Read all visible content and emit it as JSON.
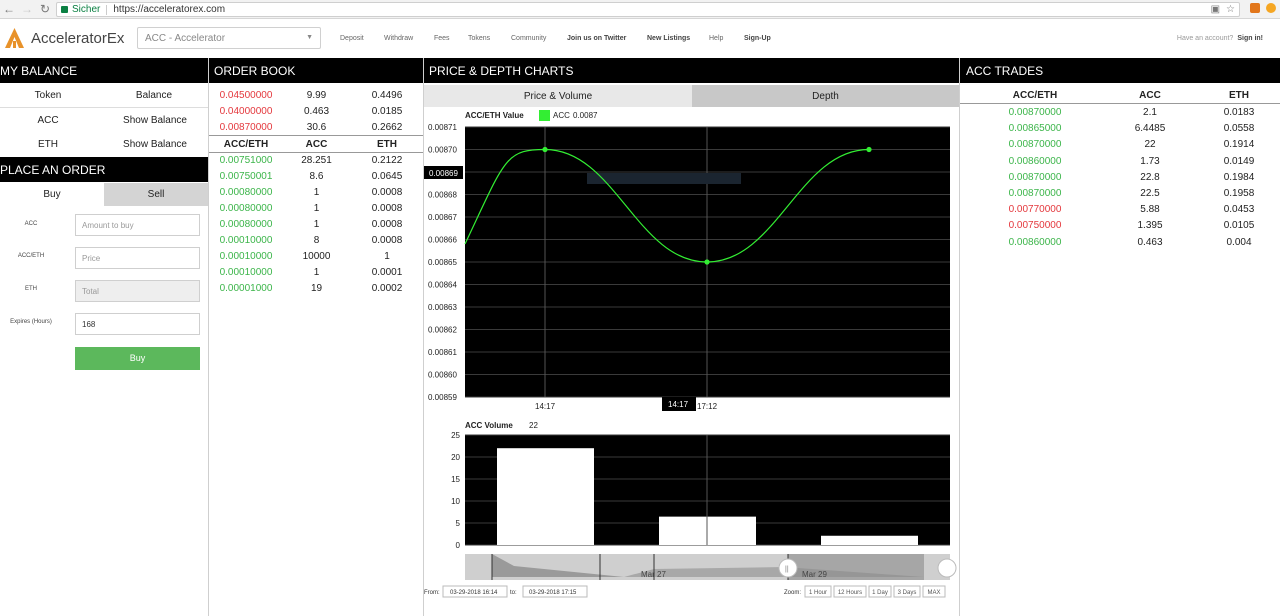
{
  "browser": {
    "secure_label": "Sicher",
    "url": "https://acceleratorex.com"
  },
  "header": {
    "brand": "AcceleratorEx",
    "pair_select": "ACC - Accelerator",
    "nav": [
      "Deposit",
      "Withdraw",
      "Fees",
      "Tokens",
      "Community",
      "Join us on Twitter",
      "New Listings",
      "Help",
      "Sign-Up"
    ],
    "have_account": "Have an account?",
    "sign_in": "Sign in!"
  },
  "balance": {
    "title": "MY BALANCE",
    "col_token": "Token",
    "col_balance": "Balance",
    "rows": [
      {
        "token": "ACC",
        "action": "Show Balance"
      },
      {
        "token": "ETH",
        "action": "Show Balance"
      }
    ]
  },
  "order_form": {
    "title": "PLACE AN ORDER",
    "tab_buy": "Buy",
    "tab_sell": "Sell",
    "label_acc": "ACC",
    "placeholder_acc": "Amount to buy",
    "label_price": "ACC/ETH",
    "placeholder_price": "Price",
    "label_eth": "ETH",
    "placeholder_total": "Total",
    "label_expires": "Expires (Hours)",
    "expires_value": "168",
    "submit": "Buy"
  },
  "order_book": {
    "title": "ORDER BOOK",
    "headers": [
      "ACC/ETH",
      "ACC",
      "ETH"
    ],
    "asks": [
      [
        "0.04500000",
        "9.99",
        "0.4496"
      ],
      [
        "0.04000000",
        "0.463",
        "0.0185"
      ],
      [
        "0.00870000",
        "30.6",
        "0.2662"
      ]
    ],
    "bids": [
      [
        "0.00751000",
        "28.251",
        "0.2122"
      ],
      [
        "0.00750001",
        "8.6",
        "0.0645"
      ],
      [
        "0.00080000",
        "1",
        "0.0008"
      ],
      [
        "0.00080000",
        "1",
        "0.0008"
      ],
      [
        "0.00080000",
        "1",
        "0.0008"
      ],
      [
        "0.00010000",
        "8",
        "0.0008"
      ],
      [
        "0.00010000",
        "10000",
        "1"
      ],
      [
        "0.00010000",
        "1",
        "0.0001"
      ],
      [
        "0.00001000",
        "19",
        "0.0002"
      ]
    ]
  },
  "charts": {
    "title": "PRICE & DEPTH CHARTS",
    "tab_price_volume": "Price & Volume",
    "tab_depth": "Depth",
    "price_title": "ACC/ETH Value",
    "legend_label": "ACC",
    "legend_value": "0.0087",
    "crosshair_y": "0.00869",
    "crosshair_x": "14:17",
    "volume_title": "ACC Volume",
    "volume_value": "22",
    "from_label": "From:",
    "from_value": "03-29-2018 16:14",
    "to_label": "to:",
    "to_value": "03-29-2018 17:15",
    "zoom_label": "Zoom:",
    "zoom_options": [
      "1 Hour",
      "12 Hours",
      "1 Day",
      "3 Days",
      "MAX"
    ],
    "navigator_labels": [
      "Mar 27",
      "Mar 29"
    ],
    "colors": {
      "line": "#33ee33",
      "plot_bg": "#000000",
      "bars": "#ffffff"
    }
  },
  "chart_data": [
    {
      "type": "line",
      "series": [
        {
          "name": "ACC",
          "x": [
            "14:17",
            "17:12",
            "end"
          ],
          "values": [
            0.0087,
            0.00865,
            0.0087
          ]
        }
      ],
      "x_ticks": [
        "14:17",
        "17:12"
      ],
      "y_ticks": [
        "0.00871",
        "0.00870",
        "0.00869",
        "0.00868",
        "0.00867",
        "0.00866",
        "0.00865",
        "0.00864",
        "0.00863",
        "0.00862",
        "0.00861",
        "0.00860",
        "0.00859"
      ],
      "ylim": [
        0.00859,
        0.00871
      ],
      "title": "ACC/ETH Value"
    },
    {
      "type": "bar",
      "values": [
        22,
        6.4485,
        2.1
      ],
      "y_ticks": [
        "25",
        "20",
        "15",
        "10",
        "5",
        "0"
      ],
      "ylim": [
        0,
        25
      ],
      "title": "ACC Volume"
    }
  ],
  "trades": {
    "title": "ACC TRADES",
    "headers": [
      "ACC/ETH",
      "ACC",
      "ETH"
    ],
    "rows": [
      {
        "price": "0.00870000",
        "acc": "2.1",
        "eth": "0.0183",
        "side": "buy"
      },
      {
        "price": "0.00865000",
        "acc": "6.4485",
        "eth": "0.0558",
        "side": "buy"
      },
      {
        "price": "0.00870000",
        "acc": "22",
        "eth": "0.1914",
        "side": "buy"
      },
      {
        "price": "0.00860000",
        "acc": "1.73",
        "eth": "0.0149",
        "side": "buy"
      },
      {
        "price": "0.00870000",
        "acc": "22.8",
        "eth": "0.1984",
        "side": "buy"
      },
      {
        "price": "0.00870000",
        "acc": "22.5",
        "eth": "0.1958",
        "side": "buy"
      },
      {
        "price": "0.00770000",
        "acc": "5.88",
        "eth": "0.0453",
        "side": "sell"
      },
      {
        "price": "0.00750000",
        "acc": "1.395",
        "eth": "0.0105",
        "side": "sell"
      },
      {
        "price": "0.00860000",
        "acc": "0.463",
        "eth": "0.004",
        "side": "buy"
      }
    ]
  }
}
